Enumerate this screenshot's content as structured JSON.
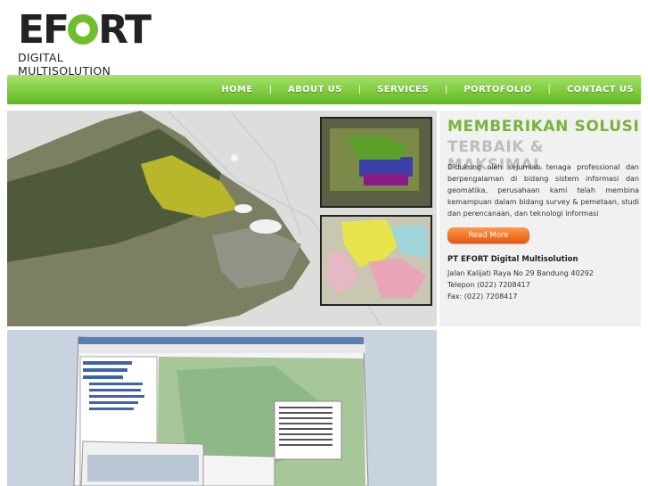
{
  "logo": {
    "word_left": "EF",
    "word_right": "RT",
    "subtitle": "DIGITAL MULTISOLUTION"
  },
  "nav": {
    "items": [
      "HOME",
      "ABOUT US",
      "SERVICES",
      "PORTOFOLIO",
      "CONTACT US"
    ],
    "separator": "|"
  },
  "hero": {
    "heading1": "MEMBERIKAN SOLUSI",
    "heading2": "TERBAIK & MAKSIMAL",
    "description": "Didukung oleh sejumlah tenaga professional dan berpengalaman di bidang sistem informasi dan geomatika, perusahaan kami telah membina kemampuan dalam bidang survey & pemetaan, studi dan perencanaan, dan teknologi informasi",
    "button": "Read More"
  },
  "company": {
    "name": "PT EFORT Digital Multisolution",
    "address": "Jalan Kalijati Raya No 29 Bandung 40292",
    "phone": "Telepon (022) 7208417",
    "fax": "Fax: (022) 7208417"
  },
  "colors": {
    "nav_green": "#6fbf2a",
    "heading_green": "#7ab33a",
    "button_orange": "#ee6b1c"
  }
}
